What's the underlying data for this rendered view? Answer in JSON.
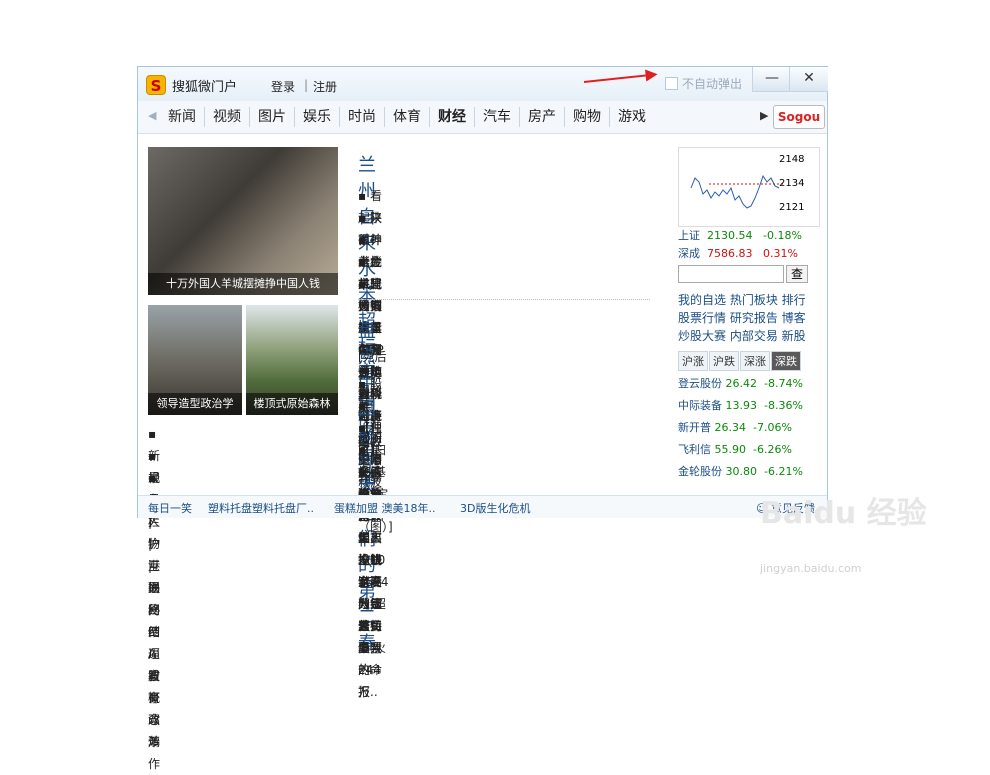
{
  "window": {
    "title": "搜狐微门户",
    "login": "登录",
    "separator": "|",
    "register": "注册",
    "auto_popup": "不自动弹出",
    "minimize": "—",
    "close": "✕"
  },
  "nav": {
    "tabs": [
      "新闻",
      "视频",
      "图片",
      "娱乐",
      "时尚",
      "体育",
      "财经",
      "汽车",
      "房产",
      "购物",
      "游戏"
    ],
    "active": "财经",
    "prev": "◀",
    "next": "▶",
    "sogou": "Sogou"
  },
  "photos": {
    "main_caption": "十万外国人羊城摆摊挣中国人钱",
    "small1_caption": "领导造型政治学",
    "small2_caption": "楼顶式原始森林"
  },
  "left_links": [
    "▪ 新视角 | 沪港通终结A股概念炒作",
    "▪ 最专栏 | 互联网倒逼教育改革",
    "▪ 最人物 | 揭秘四川富豪邓鸿"
  ],
  "headline1": "兰州自来水苯超标直指中石油",
  "news1": [
    "▪ 看起来很美：从光大银行看港股通隐患 可能亏的更惨",
    "▪ 陕西神木危机：楼市崩盘 GDP一年直降近百亿",
    "▪ 养老金并轨方案或年内出台 双轨制将画上句号",
    "▪ 楼市限购催生黑色利益链 地税等多部门沦陷",
    "▪ 官员列席董事会遭炮轰：一上厕所股市就波动"
  ],
  "headline2": "盘点中国商界大佬们的第二春",
  "sub2": "[死后就买得起房了？ 细数中国式豪华墓地（图）]",
  "news2": [
    "▪ 股票|【独家】*ST长油就该退市 投机者要为愚蠢买单",
    "▪ 【独家】投资“宝宝”不如买这10家高分红公司股票",
    "▪ 理财|扫二维码支付宝、卡钱全没 网银差点要我的命",
    "▪ 基金|基金公司去年人均赚1524万元 天弘仍亏244万",
    "▪ 香港旅游深圳出发旅游专线,超值特惠,火热报.."
  ],
  "market": {
    "chart_labels": {
      "high": "2148",
      "mid": "2134",
      "low": "2121"
    },
    "indices": [
      {
        "name": "上证",
        "value": "2130.54",
        "change": "-0.18%"
      },
      {
        "name": "深成",
        "value": "7586.83",
        "change": "0.31%"
      }
    ],
    "search_button": "查",
    "links": [
      "我的自选 热门板块 排行",
      "股票行情 研究报告 博客",
      "炒股大赛 内部交易 新股"
    ],
    "tabs": [
      "沪涨",
      "沪跌",
      "深涨",
      "深跌"
    ],
    "active_tab": "深跌",
    "stocks": [
      {
        "name": "登云股份",
        "price": "26.42",
        "change": "-8.74%"
      },
      {
        "name": "中际装备",
        "price": "13.93",
        "change": "-8.36%"
      },
      {
        "name": "新开普",
        "price": "26.34",
        "change": "-7.06%"
      },
      {
        "name": "飞利信",
        "price": "55.90",
        "change": "-6.26%"
      },
      {
        "name": "金轮股份",
        "price": "30.80",
        "change": "-6.21%"
      }
    ]
  },
  "footer": {
    "items": [
      "每日一笑",
      "塑料托盘塑料托盘厂..",
      "蛋糕加盟 澳美18年..",
      "3D版生化危机"
    ],
    "feedback": "意见反馈"
  },
  "watermark": {
    "brand": "Baidu 经验",
    "url": "jingyan.baidu.com"
  },
  "colors": {
    "link": "#1c4f86",
    "up": "#d01010",
    "down": "#0a8a0a"
  }
}
